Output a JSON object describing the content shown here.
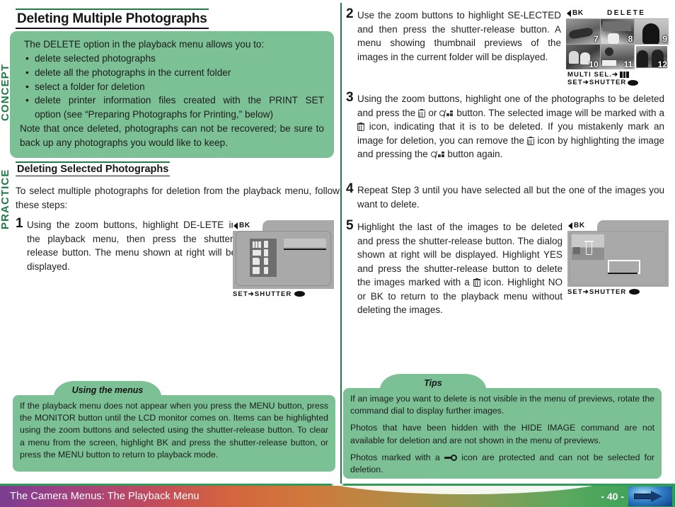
{
  "side_tabs": {
    "concept": "CONCEPT",
    "practice": "PRACTICE"
  },
  "headings": {
    "main": "Deleting Multiple Photographs",
    "sub": "Deleting Selected Photographs"
  },
  "concept_box": {
    "intro": "The DELETE option in the playback menu allows you to:",
    "bullets": [
      "delete selected photographs",
      "delete all the photographs in the current folder",
      "select a folder for deletion"
    ],
    "bullet_print_line1": "delete printer information files created with the PRINT SET",
    "bullet_print_line2": "option (see “Preparing Photographs for Printing,” below)",
    "note": "Note that once deleted, photographs can not be recovered; be sure to back up any photographs you would like to keep."
  },
  "intro_text": "To select multiple photographs for deletion from the playback menu, follow these steps:",
  "steps": {
    "s1": {
      "num": "1",
      "text": "Using the zoom buttons, highlight DE-LETE in the playback menu, then press the shutter-release button.  The menu shown at right will be displayed."
    },
    "s2": {
      "num": "2",
      "text": "Use the zoom buttons to highlight SE-LECTED and then press the shutter-release button.  A menu showing thumbnail previews of the images in the current folder will be displayed."
    },
    "s3": {
      "num": "3",
      "p1": "Using the zoom buttons, highlight one of the photographs to be deleted and press the",
      "p2": "or",
      "p3": "button.  The selected image will be marked with a",
      "p4": "icon, indicating that it is to be deleted.  If you mistakenly mark an image for deletion, you can remove the",
      "p5": "icon by highlighting the image and pressing the",
      "p6": "button again."
    },
    "s4": {
      "num": "4",
      "text": "Repeat Step 3 until you have selected all but the one of the images you want to delete."
    },
    "s5": {
      "num": "5",
      "p1": "Highlight the last of the images to be deleted and press the shutter-release button.  The dialog shown at right will be displayed.  Highlight YES and press the shutter-release button to delete the images marked with a",
      "p2": "icon.  Highlight NO or BK to return to the playback menu without deleting the images."
    }
  },
  "lcd1": {
    "back_label": "BK",
    "footer": "SET➔SHUTTER",
    "rows": 4
  },
  "lcd2": {
    "back_label": "BK",
    "title": "DELETE",
    "footer_line1": "MULTI  SEL.➔",
    "footer_line2": "SET➔SHUTTER",
    "thumbnails": [
      {
        "n": "7",
        "selected": false
      },
      {
        "n": "8",
        "selected": false
      },
      {
        "n": "9",
        "selected": false
      },
      {
        "n": "10",
        "selected": false
      },
      {
        "n": "11",
        "selected": false
      },
      {
        "n": "12",
        "selected": true
      }
    ]
  },
  "lcd3": {
    "back_label": "BK",
    "footer": "SET➔SHUTTER"
  },
  "tip_left": {
    "title": "Using the menus",
    "body": "If the playback menu does not appear when you press the MENU button, press the MONITOR button until the LCD monitor comes on.  Items can be highlighted using the zoom buttons and selected using the shutter-release button.  To clear a menu from the screen, highlight BK and press the shutter-release button, or press the MENU button to return to playback mode."
  },
  "tip_right": {
    "title": "Tips",
    "p1": "If an image you want to delete is not visible in the menu of previews, rotate the command dial to display further images.",
    "p2": "Photos that have been hidden with the HIDE IMAGE command are not available for deletion and are not shown in the menu of previews.",
    "p3a": "Photos marked with a",
    "p3b": "icon are protected and can not be selected for deletion."
  },
  "footer": {
    "title": "The Camera Menus: The Playback Menu",
    "page": "- 40 -"
  },
  "colors": {
    "green_box": "#7cc095",
    "green_rule": "#1f7a45",
    "lcd_gray": "#a9a9a9"
  }
}
